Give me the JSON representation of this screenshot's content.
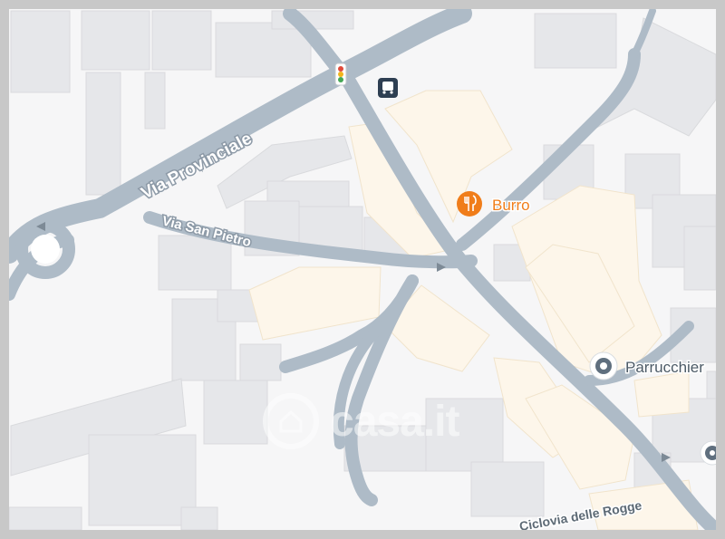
{
  "map": {
    "roads": {
      "via_provinciale": "Via Provinciale",
      "via_san_pietro": "Via San Pietro",
      "ciclovia": "Ciclovia delle Rogge"
    },
    "pois": {
      "burro": "Burro",
      "parrucchiere": "Parrucchier"
    },
    "watermark": "casa.it",
    "colors": {
      "background": "#f6f6f7",
      "building": "#e6e7ea",
      "highlight_building": "#fdf6ea",
      "road": "#aebbc7",
      "restaurant_accent": "#f07d1a",
      "poi_accent": "#5f6f7e"
    }
  }
}
